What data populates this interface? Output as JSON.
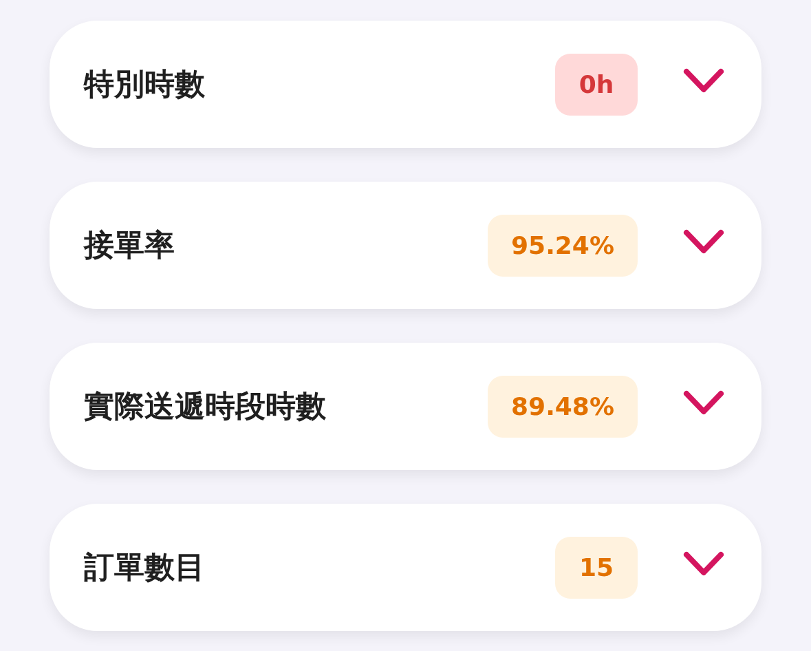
{
  "items": [
    {
      "label": "特別時數",
      "value": "0h",
      "kind": "danger",
      "expanded": false
    },
    {
      "label": "接單率",
      "value": "95.24%",
      "kind": "warning",
      "expanded": false
    },
    {
      "label": "實際送遞時段時數",
      "value": "89.48%",
      "kind": "warning",
      "expanded": false
    },
    {
      "label": "訂單數目",
      "value": "15",
      "kind": "warning",
      "expanded": false
    }
  ]
}
